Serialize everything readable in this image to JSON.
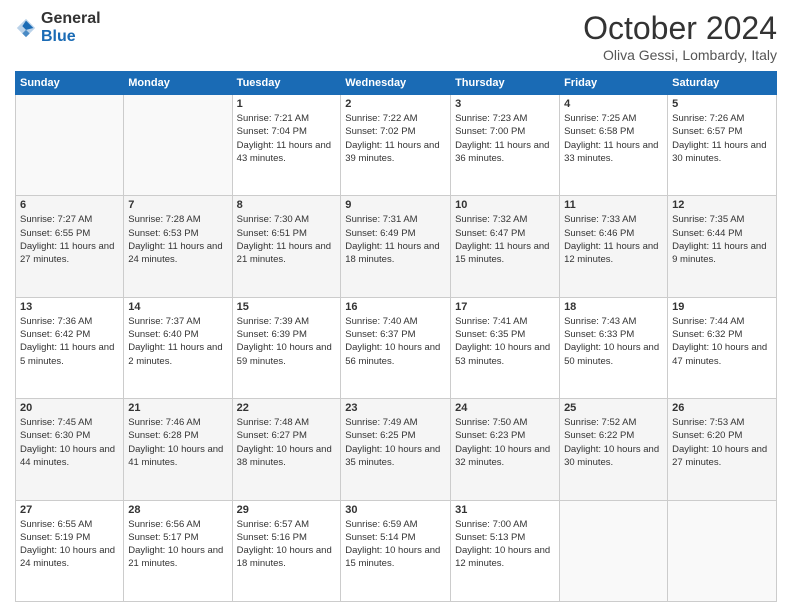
{
  "header": {
    "logo_general": "General",
    "logo_blue": "Blue",
    "month_title": "October 2024",
    "location": "Oliva Gessi, Lombardy, Italy"
  },
  "days_of_week": [
    "Sunday",
    "Monday",
    "Tuesday",
    "Wednesday",
    "Thursday",
    "Friday",
    "Saturday"
  ],
  "weeks": [
    [
      {
        "day": "",
        "sunrise": "",
        "sunset": "",
        "daylight": ""
      },
      {
        "day": "",
        "sunrise": "",
        "sunset": "",
        "daylight": ""
      },
      {
        "day": "1",
        "sunrise": "Sunrise: 7:21 AM",
        "sunset": "Sunset: 7:04 PM",
        "daylight": "Daylight: 11 hours and 43 minutes."
      },
      {
        "day": "2",
        "sunrise": "Sunrise: 7:22 AM",
        "sunset": "Sunset: 7:02 PM",
        "daylight": "Daylight: 11 hours and 39 minutes."
      },
      {
        "day": "3",
        "sunrise": "Sunrise: 7:23 AM",
        "sunset": "Sunset: 7:00 PM",
        "daylight": "Daylight: 11 hours and 36 minutes."
      },
      {
        "day": "4",
        "sunrise": "Sunrise: 7:25 AM",
        "sunset": "Sunset: 6:58 PM",
        "daylight": "Daylight: 11 hours and 33 minutes."
      },
      {
        "day": "5",
        "sunrise": "Sunrise: 7:26 AM",
        "sunset": "Sunset: 6:57 PM",
        "daylight": "Daylight: 11 hours and 30 minutes."
      }
    ],
    [
      {
        "day": "6",
        "sunrise": "Sunrise: 7:27 AM",
        "sunset": "Sunset: 6:55 PM",
        "daylight": "Daylight: 11 hours and 27 minutes."
      },
      {
        "day": "7",
        "sunrise": "Sunrise: 7:28 AM",
        "sunset": "Sunset: 6:53 PM",
        "daylight": "Daylight: 11 hours and 24 minutes."
      },
      {
        "day": "8",
        "sunrise": "Sunrise: 7:30 AM",
        "sunset": "Sunset: 6:51 PM",
        "daylight": "Daylight: 11 hours and 21 minutes."
      },
      {
        "day": "9",
        "sunrise": "Sunrise: 7:31 AM",
        "sunset": "Sunset: 6:49 PM",
        "daylight": "Daylight: 11 hours and 18 minutes."
      },
      {
        "day": "10",
        "sunrise": "Sunrise: 7:32 AM",
        "sunset": "Sunset: 6:47 PM",
        "daylight": "Daylight: 11 hours and 15 minutes."
      },
      {
        "day": "11",
        "sunrise": "Sunrise: 7:33 AM",
        "sunset": "Sunset: 6:46 PM",
        "daylight": "Daylight: 11 hours and 12 minutes."
      },
      {
        "day": "12",
        "sunrise": "Sunrise: 7:35 AM",
        "sunset": "Sunset: 6:44 PM",
        "daylight": "Daylight: 11 hours and 9 minutes."
      }
    ],
    [
      {
        "day": "13",
        "sunrise": "Sunrise: 7:36 AM",
        "sunset": "Sunset: 6:42 PM",
        "daylight": "Daylight: 11 hours and 5 minutes."
      },
      {
        "day": "14",
        "sunrise": "Sunrise: 7:37 AM",
        "sunset": "Sunset: 6:40 PM",
        "daylight": "Daylight: 11 hours and 2 minutes."
      },
      {
        "day": "15",
        "sunrise": "Sunrise: 7:39 AM",
        "sunset": "Sunset: 6:39 PM",
        "daylight": "Daylight: 10 hours and 59 minutes."
      },
      {
        "day": "16",
        "sunrise": "Sunrise: 7:40 AM",
        "sunset": "Sunset: 6:37 PM",
        "daylight": "Daylight: 10 hours and 56 minutes."
      },
      {
        "day": "17",
        "sunrise": "Sunrise: 7:41 AM",
        "sunset": "Sunset: 6:35 PM",
        "daylight": "Daylight: 10 hours and 53 minutes."
      },
      {
        "day": "18",
        "sunrise": "Sunrise: 7:43 AM",
        "sunset": "Sunset: 6:33 PM",
        "daylight": "Daylight: 10 hours and 50 minutes."
      },
      {
        "day": "19",
        "sunrise": "Sunrise: 7:44 AM",
        "sunset": "Sunset: 6:32 PM",
        "daylight": "Daylight: 10 hours and 47 minutes."
      }
    ],
    [
      {
        "day": "20",
        "sunrise": "Sunrise: 7:45 AM",
        "sunset": "Sunset: 6:30 PM",
        "daylight": "Daylight: 10 hours and 44 minutes."
      },
      {
        "day": "21",
        "sunrise": "Sunrise: 7:46 AM",
        "sunset": "Sunset: 6:28 PM",
        "daylight": "Daylight: 10 hours and 41 minutes."
      },
      {
        "day": "22",
        "sunrise": "Sunrise: 7:48 AM",
        "sunset": "Sunset: 6:27 PM",
        "daylight": "Daylight: 10 hours and 38 minutes."
      },
      {
        "day": "23",
        "sunrise": "Sunrise: 7:49 AM",
        "sunset": "Sunset: 6:25 PM",
        "daylight": "Daylight: 10 hours and 35 minutes."
      },
      {
        "day": "24",
        "sunrise": "Sunrise: 7:50 AM",
        "sunset": "Sunset: 6:23 PM",
        "daylight": "Daylight: 10 hours and 32 minutes."
      },
      {
        "day": "25",
        "sunrise": "Sunrise: 7:52 AM",
        "sunset": "Sunset: 6:22 PM",
        "daylight": "Daylight: 10 hours and 30 minutes."
      },
      {
        "day": "26",
        "sunrise": "Sunrise: 7:53 AM",
        "sunset": "Sunset: 6:20 PM",
        "daylight": "Daylight: 10 hours and 27 minutes."
      }
    ],
    [
      {
        "day": "27",
        "sunrise": "Sunrise: 6:55 AM",
        "sunset": "Sunset: 5:19 PM",
        "daylight": "Daylight: 10 hours and 24 minutes."
      },
      {
        "day": "28",
        "sunrise": "Sunrise: 6:56 AM",
        "sunset": "Sunset: 5:17 PM",
        "daylight": "Daylight: 10 hours and 21 minutes."
      },
      {
        "day": "29",
        "sunrise": "Sunrise: 6:57 AM",
        "sunset": "Sunset: 5:16 PM",
        "daylight": "Daylight: 10 hours and 18 minutes."
      },
      {
        "day": "30",
        "sunrise": "Sunrise: 6:59 AM",
        "sunset": "Sunset: 5:14 PM",
        "daylight": "Daylight: 10 hours and 15 minutes."
      },
      {
        "day": "31",
        "sunrise": "Sunrise: 7:00 AM",
        "sunset": "Sunset: 5:13 PM",
        "daylight": "Daylight: 10 hours and 12 minutes."
      },
      {
        "day": "",
        "sunrise": "",
        "sunset": "",
        "daylight": ""
      },
      {
        "day": "",
        "sunrise": "",
        "sunset": "",
        "daylight": ""
      }
    ]
  ]
}
